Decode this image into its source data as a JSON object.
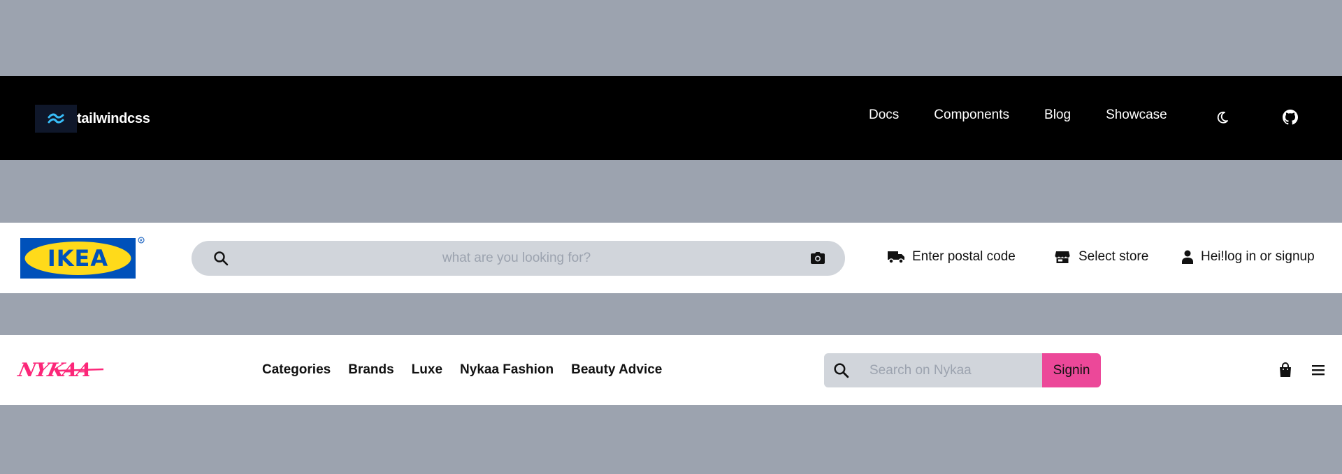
{
  "tailwind_nav": {
    "brand": "tailwindcss",
    "links": [
      "Docs",
      "Components",
      "Blog",
      "Showcase"
    ],
    "icons": [
      "moon-icon",
      "github-icon"
    ],
    "colors": {
      "background": "#000000",
      "logo_bg": "#0f172a",
      "logo_accent": "#38bdf8"
    }
  },
  "ikea_nav": {
    "brand": "IKEA",
    "search": {
      "placeholder": "what are you looking for?",
      "value": ""
    },
    "actions": [
      {
        "icon": "truck-icon",
        "label": "Enter postal code"
      },
      {
        "icon": "store-icon",
        "label": "Select store"
      },
      {
        "icon": "user-icon",
        "label": "Hei!log in or signup"
      }
    ],
    "colors": {
      "logo_blue": "#0051ba",
      "logo_yellow": "#ffda1a",
      "search_bg": "#d1d5db"
    }
  },
  "nykaa_nav": {
    "brand": "NYKAA",
    "links": [
      "Categories",
      "Brands",
      "Luxe",
      "Nykaa Fashion",
      "Beauty Advice"
    ],
    "search": {
      "placeholder": "Search on Nykaa",
      "value": ""
    },
    "signin_label": "Signin",
    "icons": [
      "shopping-bag-icon",
      "hamburger-menu-icon"
    ],
    "colors": {
      "brand_pink": "#ec4899",
      "logo_pink": "#fc2779"
    }
  }
}
